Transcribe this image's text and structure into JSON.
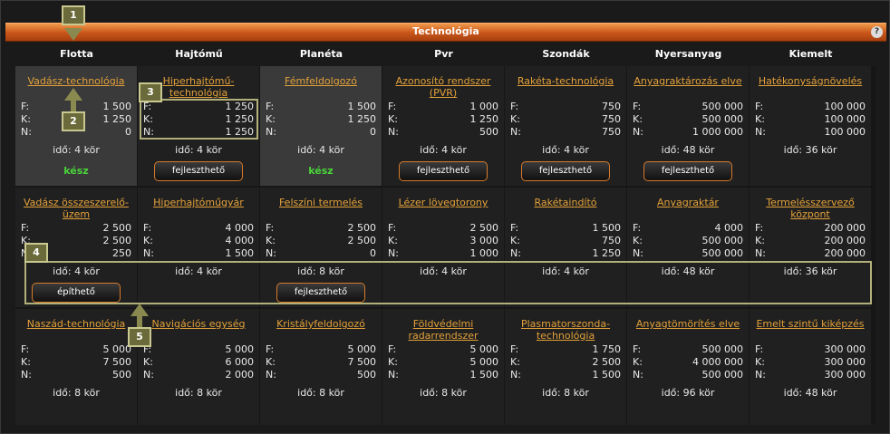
{
  "window": {
    "title": "Technológia",
    "help_label": "?"
  },
  "columns": [
    "Flotta",
    "Hajtómű",
    "Planéta",
    "Pvr",
    "Szondák",
    "Nyersanyag",
    "Kiemelt"
  ],
  "labels": {
    "f": "F:",
    "k": "K:",
    "n": "N:"
  },
  "rows": [
    [
      {
        "name": "Vadász-technológia",
        "f": "1 500",
        "k": "1 250",
        "n": "0",
        "ido": "idő: 4 kör",
        "status": "kész"
      },
      {
        "name": "Hiperhajtómű-technológia",
        "f": "1 250",
        "k": "1 250",
        "n": "1 250",
        "ido": "idő: 4 kör",
        "button": "fejleszthető"
      },
      {
        "name": "Fémfeldolgozó",
        "f": "1 500",
        "k": "1 250",
        "n": "0",
        "ido": "idő: 4 kör",
        "status": "kész"
      },
      {
        "name": "Azonosító rendszer (PVR)",
        "f": "1 000",
        "k": "1 250",
        "n": "500",
        "ido": "idő: 4 kör",
        "button": "fejleszthető"
      },
      {
        "name": "Rakéta-technológia",
        "f": "750",
        "k": "750",
        "n": "750",
        "ido": "idő: 4 kör",
        "button": "fejleszthető"
      },
      {
        "name": "Anyagraktározás elve",
        "f": "500 000",
        "k": "500 000",
        "n": "1 000 000",
        "ido": "idő: 48 kör",
        "button": "fejleszthető"
      },
      {
        "name": "Hatékonyságnövelés",
        "f": "100 000",
        "k": "100 000",
        "n": "100 000",
        "ido": "idő: 36 kör"
      }
    ],
    [
      {
        "name": "Vadász összeszerelő-üzem",
        "f": "2 500",
        "k": "2 500",
        "n": "250",
        "ido": "idő: 4 kör",
        "button": "építhető"
      },
      {
        "name": "Hiperhajtóműgyár",
        "f": "4 000",
        "k": "4 000",
        "n": "1 500",
        "ido": "idő: 4 kör"
      },
      {
        "name": "Felszíni termelés",
        "f": "2 500",
        "k": "2 500",
        "n": "0",
        "ido": "idő: 8 kör",
        "button": "fejleszthető"
      },
      {
        "name": "Lézer lövegtorony",
        "f": "2 500",
        "k": "3 000",
        "n": "1 000",
        "ido": "idő: 4 kör"
      },
      {
        "name": "Rakétaindító",
        "f": "1 500",
        "k": "750",
        "n": "1 250",
        "ido": "idő: 4 kör"
      },
      {
        "name": "Anyagraktár",
        "f": "4 000",
        "k": "500 000",
        "n": "500 000",
        "ido": "idő: 48 kör"
      },
      {
        "name": "Termelésszervező központ",
        "f": "200 000",
        "k": "200 000",
        "n": "200 000",
        "ido": "idő: 36 kör"
      }
    ],
    [
      {
        "name": "Naszád-technológia",
        "f": "5 000",
        "k": "7 500",
        "n": "500",
        "ido": "idő: 8 kör"
      },
      {
        "name": "Navigációs egység",
        "f": "5 000",
        "k": "6 000",
        "n": "2 000",
        "ido": "idő: 8 kör"
      },
      {
        "name": "Kristályfeldolgozó",
        "f": "5 000",
        "k": "7 500",
        "n": "500",
        "ido": "idő: 8 kör"
      },
      {
        "name": "Földvédelmi radarrendszer",
        "f": "5 000",
        "k": "5 000",
        "n": "1 500",
        "ido": "idő: 8 kör"
      },
      {
        "name": "Plasmatorszonda-technológia",
        "f": "1 750",
        "k": "2 500",
        "n": "1 500",
        "ido": "idő: 8 kör"
      },
      {
        "name": "Anyagtömörítés elve",
        "f": "500 000",
        "k": "4 000 000",
        "n": "500 000",
        "ido": "idő: 96 kör"
      },
      {
        "name": "Emelt szintű kiképzés",
        "f": "300 000",
        "k": "300 000",
        "n": "300 000",
        "ido": "idő: 48 kör"
      }
    ]
  ],
  "markers": [
    "1",
    "2",
    "3",
    "4",
    "5"
  ],
  "colors": {
    "accent": "#e3a13a",
    "titlebar": "#c8551a",
    "done": "#4ad43a",
    "button_border": "#d57a2a",
    "callout": "#b2b07a"
  }
}
